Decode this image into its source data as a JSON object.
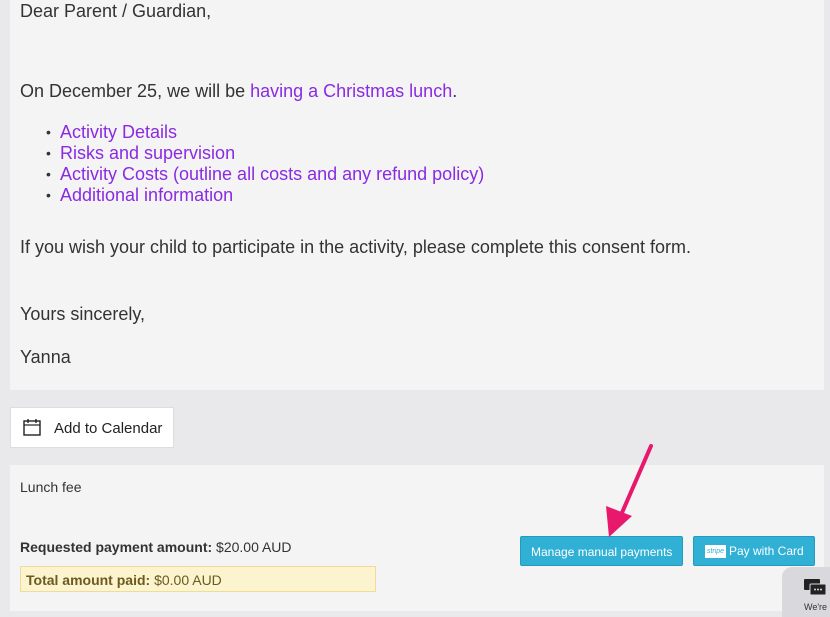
{
  "letter": {
    "greeting": "Dear Parent / Guardian,",
    "intro_prefix": "On December 25, we will be ",
    "intro_link": "having a Christmas lunch",
    "intro_suffix": ".",
    "bullets": [
      "Activity Details",
      "Risks and supervision",
      "Activity Costs (outline all costs and any refund policy)",
      "Additional information"
    ],
    "consent_text": "If you wish your child to participate in the activity, please complete this consent form.",
    "closing": "Yours sincerely,",
    "signature": "Yanna"
  },
  "calendar": {
    "label": "Add to Calendar",
    "icon": "calendar-icon"
  },
  "payment": {
    "fee_name": "Lunch fee",
    "requested_label": "Requested payment amount:",
    "requested_value": "$20.00 AUD",
    "paid_label": "Total amount paid:",
    "paid_value": "$0.00 AUD",
    "manual_button": "Manage manual payments",
    "card_button": "Pay with Card",
    "stripe_badge": "stripe"
  },
  "chat": {
    "partial_text": "We're",
    "icon": "chat-icon"
  },
  "colors": {
    "link_purple": "#8a2be2",
    "button_blue": "#31b0d5",
    "arrow_pink": "#e8186d",
    "paid_highlight": "#fcf3cf"
  }
}
